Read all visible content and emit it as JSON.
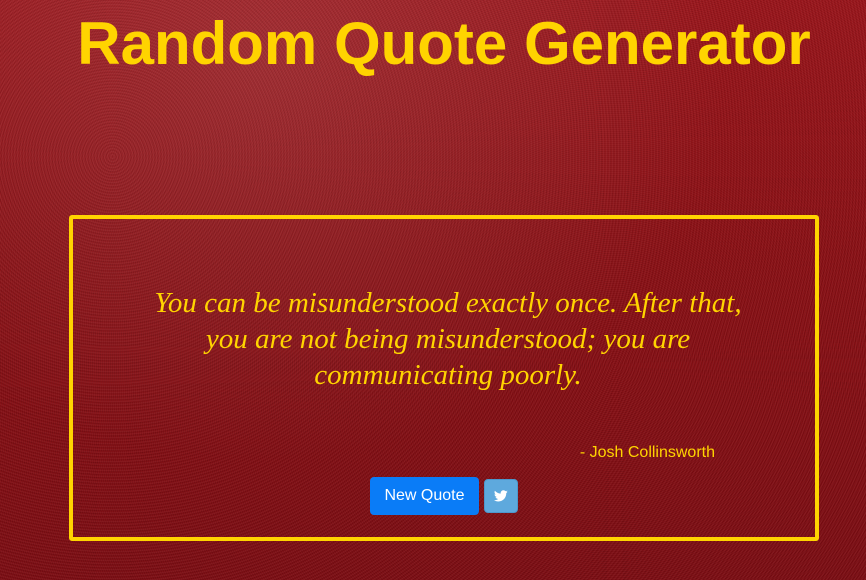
{
  "header": {
    "title": "Random Quote Generator"
  },
  "quote": {
    "text": "You can be misunderstood exactly once. After that, you are not being misunderstood; you are communicating poorly.",
    "author": "- Josh Collinsworth"
  },
  "actions": {
    "new_quote_label": "New Quote",
    "tweet_icon": "twitter-icon"
  },
  "colors": {
    "background": "#8a0d12",
    "accent": "#ffd400",
    "primary_button": "#0a7cf7",
    "twitter_button": "#5ea9dd"
  }
}
